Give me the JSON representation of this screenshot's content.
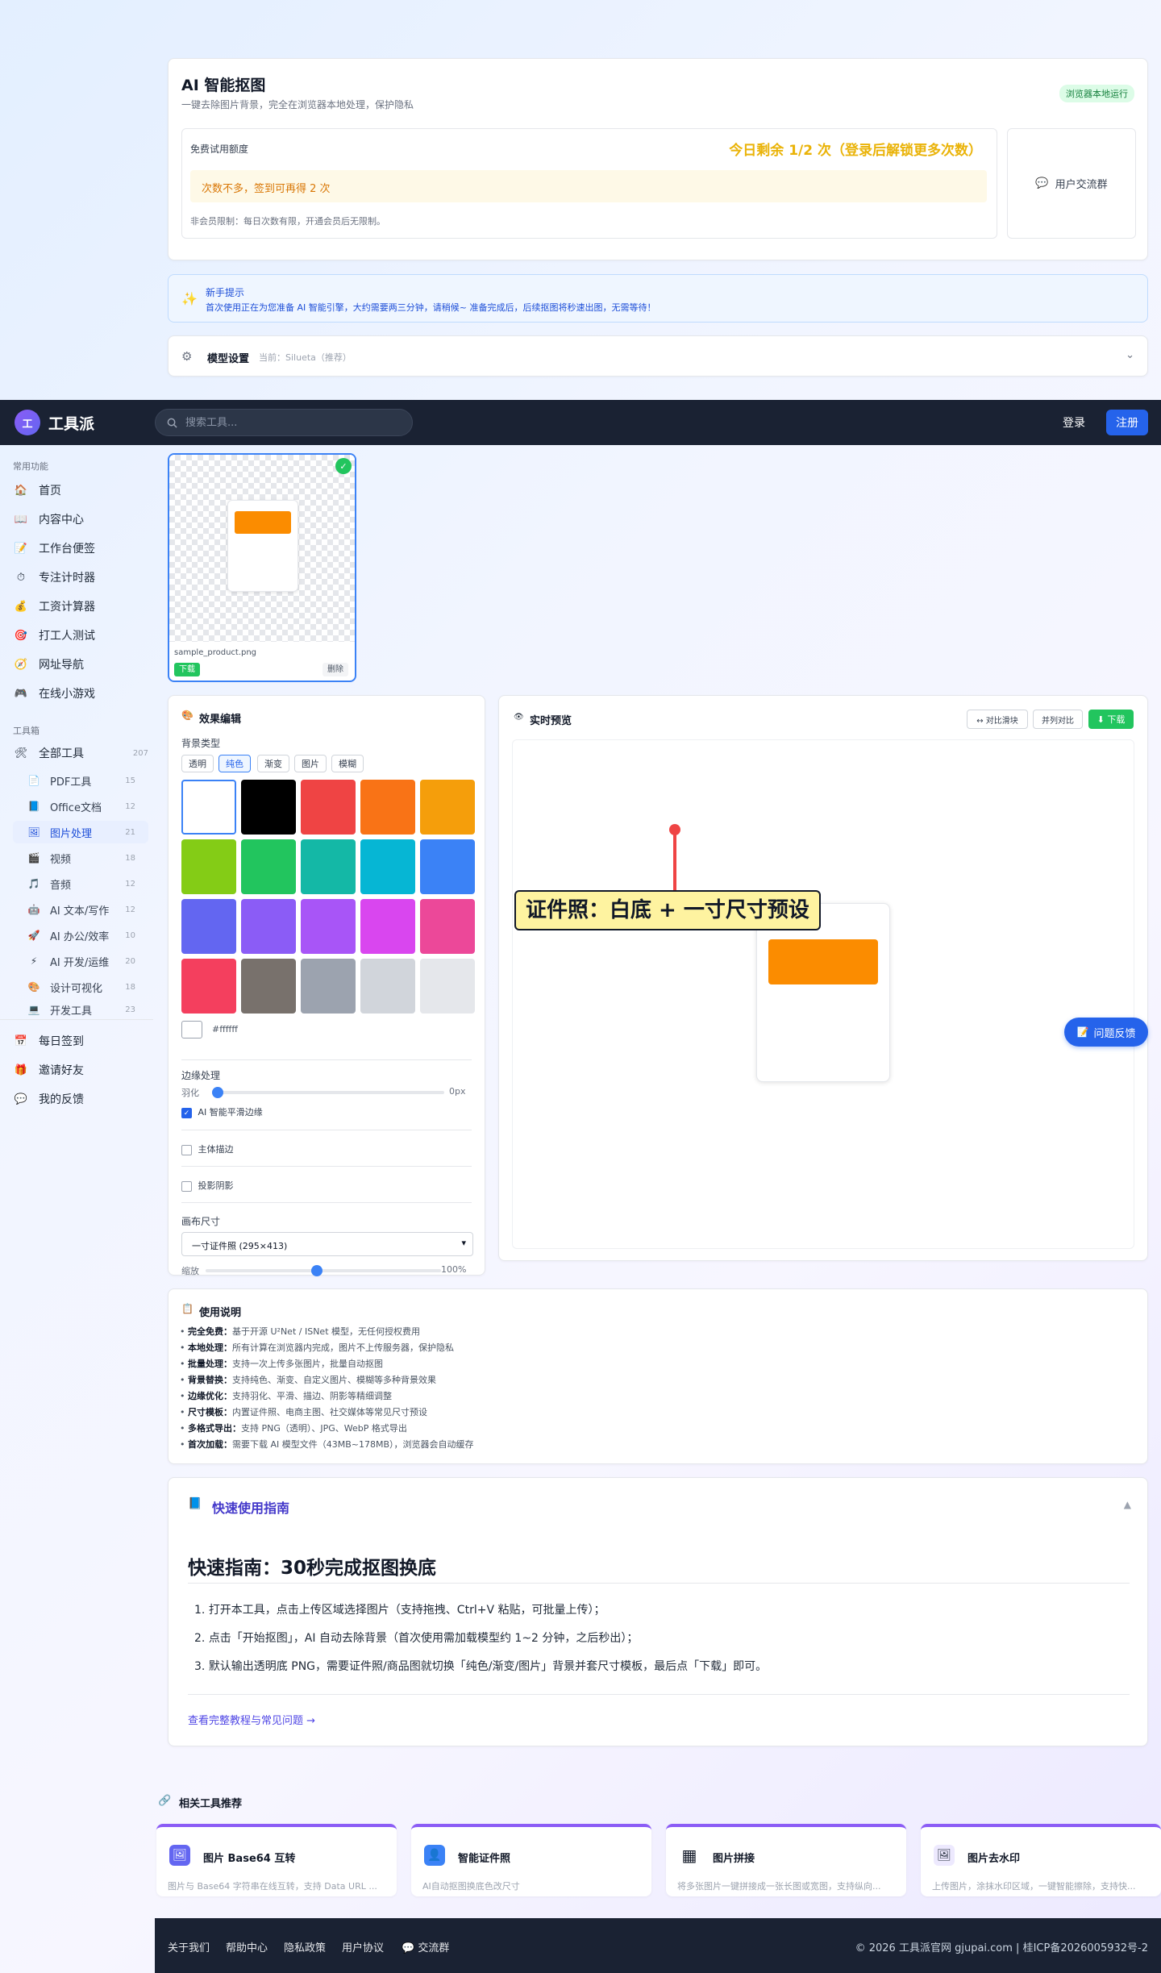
{
  "header_card": {
    "title": "AI 智能抠图",
    "subtitle": "一键去除图片背景，完全在浏览器本地处理，保护隐私",
    "badge": "浏览器本地运行",
    "quota_label": "免费试用额度",
    "quota_value": "今日剩余 1/2 次（登录后解锁更多次数）",
    "warning": "次数不多，签到可再得 2 次",
    "note": "非会员限制：每日次数有限，开通会员后无限制。",
    "community": "用户交流群"
  },
  "tip": {
    "title": "新手提示",
    "text": "首次使用正在为您准备 AI 智能引擎，大约需要两三分钟，请稍候~ 准备完成后，后续抠图将秒速出图，无需等待！"
  },
  "model": {
    "label": "模型设置",
    "current": "当前：Silueta（推荐）"
  },
  "nav": {
    "logo_text": "工",
    "brand": "工具派",
    "search_placeholder": "搜索工具...",
    "login": "登录",
    "signup": "注册"
  },
  "sidebar": {
    "section_common": "常用功能",
    "common": [
      {
        "icon": "🏠",
        "label": "首页"
      },
      {
        "icon": "📖",
        "label": "内容中心"
      },
      {
        "icon": "📝",
        "label": "工作台便签"
      },
      {
        "icon": "⏱",
        "label": "专注计时器"
      },
      {
        "icon": "💰",
        "label": "工资计算器"
      },
      {
        "icon": "🎯",
        "label": "打工人测试"
      },
      {
        "icon": "🧭",
        "label": "网址导航"
      },
      {
        "icon": "🎮",
        "label": "在线小游戏"
      }
    ],
    "section_tools": "工具箱",
    "all_tools": {
      "icon": "🛠",
      "label": "全部工具",
      "count": "207"
    },
    "tools": [
      {
        "icon": "📄",
        "label": "PDF工具",
        "count": "15"
      },
      {
        "icon": "📘",
        "label": "Office文档",
        "count": "12"
      },
      {
        "icon": "🖼",
        "label": "图片处理",
        "count": "21"
      },
      {
        "icon": "🎬",
        "label": "视频",
        "count": "18"
      },
      {
        "icon": "🎵",
        "label": "音频",
        "count": "12"
      },
      {
        "icon": "🤖",
        "label": "AI 文本/写作",
        "count": "12"
      },
      {
        "icon": "🚀",
        "label": "AI 办公/效率",
        "count": "10"
      },
      {
        "icon": "⚡",
        "label": "AI 开发/运维",
        "count": "20"
      },
      {
        "icon": "🎨",
        "label": "设计可视化",
        "count": "18"
      },
      {
        "icon": "💻",
        "label": "开发工具",
        "count": "23"
      }
    ],
    "bottom": [
      {
        "icon": "📅",
        "label": "每日签到"
      },
      {
        "icon": "🎁",
        "label": "邀请好友"
      },
      {
        "icon": "💬",
        "label": "我的反馈"
      }
    ]
  },
  "image_card": {
    "filename": "sample_product.png",
    "download": "下载",
    "delete": "删除"
  },
  "editor": {
    "title": "效果编辑",
    "bg_type_label": "背景类型",
    "bg_tabs": [
      "透明",
      "纯色",
      "渐变",
      "图片",
      "模糊"
    ],
    "active_tab": "纯色",
    "colors": [
      "#ffffff",
      "#000000",
      "#ef4444",
      "#f97316",
      "#f59e0b",
      "#84cc16",
      "#22c55e",
      "#14b8a6",
      "#06b6d4",
      "#3b82f6",
      "#6366f1",
      "#8b5cf6",
      "#a855f7",
      "#d946ef",
      "#ec4899",
      "#f43f5e",
      "#78716c",
      "#9ca3af",
      "#d1d5db",
      "#e5e7eb"
    ],
    "selected_color": "#ffffff",
    "edge_label": "边缘处理",
    "feather_label": "羽化",
    "feather_value": "0px",
    "feather_fraction": 0,
    "smooth_label": "AI 智能平滑边缘",
    "smooth_checked": true,
    "outline_label": "主体描边",
    "shadow_label": "投影阴影",
    "canvas_label": "画布尺寸",
    "canvas_option": "一寸证件照 (295×413)",
    "zoom_label": "缩放",
    "zoom_value": "100%",
    "zoom_fraction": 0.47
  },
  "preview": {
    "title": "实时预览",
    "compare_slider": "↔ 对比滑块",
    "side_by_side": "并列对比",
    "download": "⬇ 下载",
    "callout": "证件照：白底 + 一寸尺寸预设",
    "feedback": "问题反馈"
  },
  "usage": {
    "title": "使用说明",
    "items": [
      {
        "label": "完全免费：",
        "text": "基于开源 U²Net / ISNet 模型，无任何授权费用"
      },
      {
        "label": "本地处理：",
        "text": "所有计算在浏览器内完成，图片不上传服务器，保护隐私"
      },
      {
        "label": "批量处理：",
        "text": "支持一次上传多张图片，批量自动抠图"
      },
      {
        "label": "背景替换：",
        "text": "支持纯色、渐变、自定义图片、模糊等多种背景效果"
      },
      {
        "label": "边缘优化：",
        "text": "支持羽化、平滑、描边、阴影等精细调整"
      },
      {
        "label": "尺寸模板：",
        "text": "内置证件照、电商主图、社交媒体等常见尺寸预设"
      },
      {
        "label": "多格式导出：",
        "text": "支持 PNG（透明）、JPG、WebP 格式导出"
      },
      {
        "label": "首次加载：",
        "text": "需要下载 AI 模型文件（43MB~178MB），浏览器会自动缓存"
      }
    ]
  },
  "guide": {
    "header": "快速使用指南",
    "title": "快速指南：30秒完成抠图换底",
    "steps": [
      "打开本工具，点击上传区域选择图片（支持拖拽、Ctrl+V 粘贴，可批量上传）；",
      "点击「开始抠图」，AI 自动去除背景（首次使用需加载模型约 1~2 分钟，之后秒出）；",
      "默认输出透明底 PNG，需要证件照/商品图就切换「纯色/渐变/图片」背景并套尺寸模板，最后点「下载」即可。"
    ],
    "link": "查看完整教程与常见问题 →"
  },
  "related": {
    "title": "相关工具推荐",
    "items": [
      {
        "icon": "🖼",
        "title": "图片 Base64 互转",
        "desc": "图片与 Base64 字符串在线互转，支持 Data URL ...",
        "bg": "#6366f1"
      },
      {
        "icon": "👤",
        "title": "智能证件照",
        "desc": "AI自动抠图换底色改尺寸",
        "bg": "#3b82f6"
      },
      {
        "icon": "▦",
        "title": "图片拼接",
        "desc": "将多张图片一键拼接成一张长图或宽图，支持纵向...",
        "bg": "#ffffff"
      },
      {
        "icon": "🖼",
        "title": "图片去水印",
        "desc": "上传图片，涂抹水印区域，一键智能擦除，支持快...",
        "bg": "#ede9fe"
      }
    ]
  },
  "footer": {
    "links": [
      "关于我们",
      "帮助中心",
      "隐私政策",
      "用户协议",
      "💬 交流群"
    ],
    "copyright": "© 2026 工具派官网 gjupai.com | 桂ICP备2026005932号-2"
  },
  "colors": {
    "accent": "#2563eb",
    "nav_bg": "#1a2233",
    "success": "#22c55e",
    "warning_text": "#d97706",
    "quota_text": "#eab308"
  }
}
